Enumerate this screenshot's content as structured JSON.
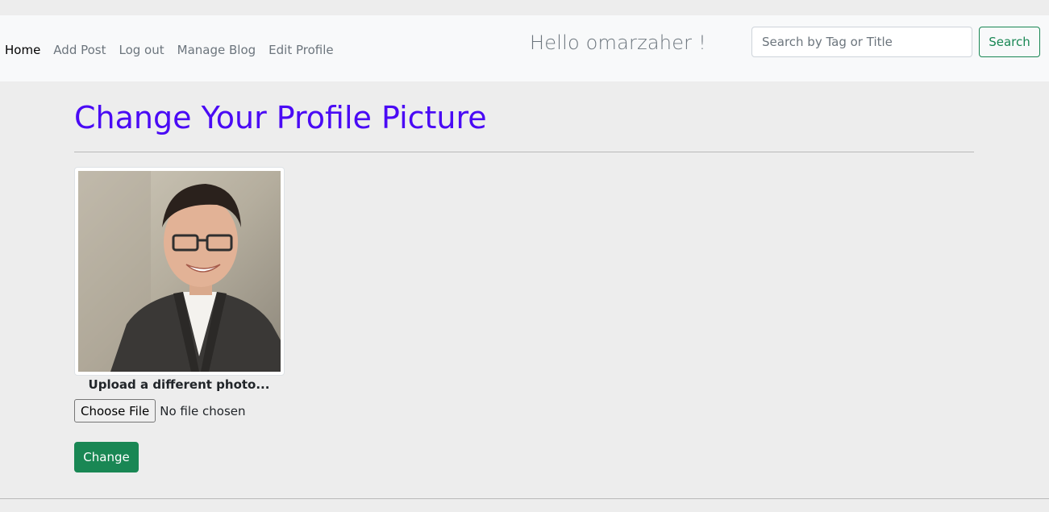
{
  "nav": {
    "items": [
      {
        "label": "Home",
        "active": true
      },
      {
        "label": "Add Post",
        "active": false
      },
      {
        "label": "Log out",
        "active": false
      },
      {
        "label": "Manage Blog",
        "active": false
      },
      {
        "label": "Edit Profile",
        "active": false
      }
    ],
    "greeting": "Hello omarzaher !",
    "search": {
      "placeholder": "Search by Tag or Title",
      "value": "",
      "button_label": "Search"
    }
  },
  "main": {
    "title": "Change Your Profile Picture",
    "upload_caption": "Upload a different photo...",
    "file_input": {
      "button_label": "Choose File",
      "status": "No file chosen"
    },
    "submit_label": "Change"
  },
  "colors": {
    "title": "#4a0af5",
    "success": "#198754",
    "navbar_bg": "#f8f9fa",
    "page_bg": "#ededed"
  }
}
